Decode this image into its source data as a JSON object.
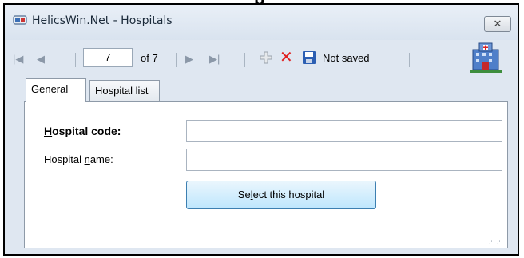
{
  "window": {
    "title": "HelicsWin.Net - Hospitals",
    "close_label": "✕"
  },
  "toolbar": {
    "first_icon": "|◀",
    "prev_icon": "◀",
    "page_value": "7",
    "page_total": "of 7",
    "next_icon": "▶",
    "last_icon": "▶|",
    "status": "Not saved"
  },
  "tabs": [
    {
      "label": "General",
      "active": true
    },
    {
      "label": "Hospital list",
      "active": false
    }
  ],
  "form": {
    "code_label_u": "H",
    "code_label_rest": "ospital code:",
    "code_value": "",
    "name_label_pre": "Hospital ",
    "name_label_u": "n",
    "name_label_post": "ame:",
    "name_value": "",
    "button_pre": "Se",
    "button_u": "l",
    "button_post": "ect this hospital"
  },
  "icons": {
    "app": "hospital-app-icon",
    "add": "plus-icon",
    "delete": "delete-x-icon",
    "save": "floppy-save-icon",
    "logo": "hospital-building-icon"
  }
}
